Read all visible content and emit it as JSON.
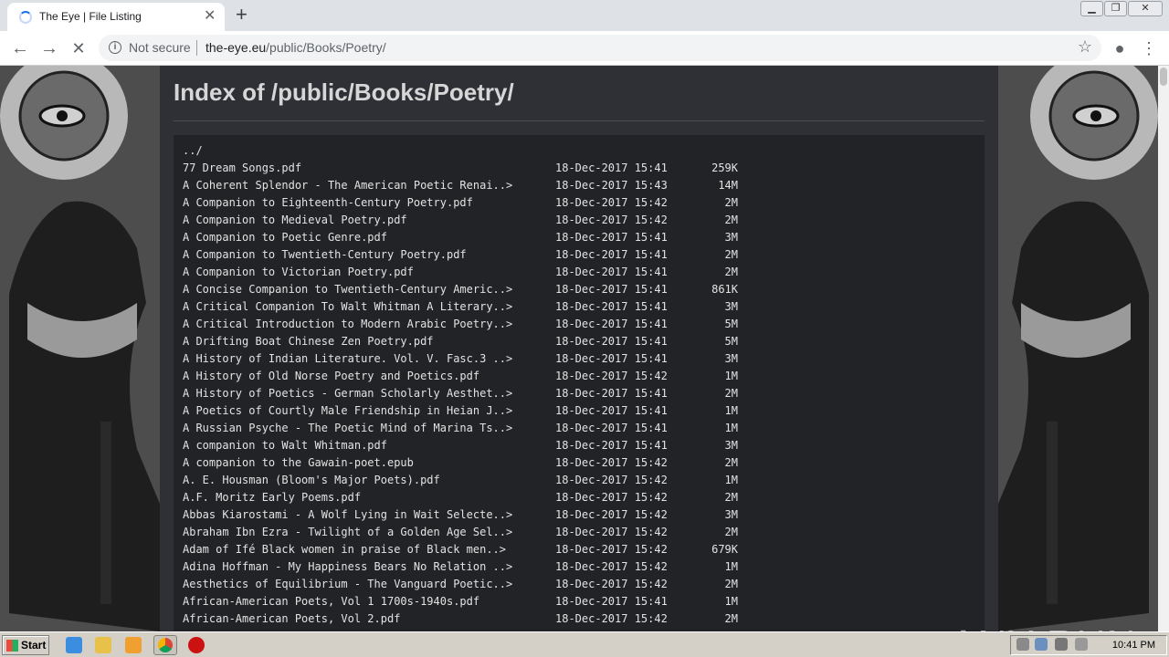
{
  "browser": {
    "tab_title": "The Eye | File Listing",
    "tab_close": "✕",
    "new_tab": "+",
    "not_secure": "Not secure",
    "url_host": "the-eye.eu",
    "url_path": "/public/Books/Poetry/"
  },
  "page": {
    "heading": "Index of /public/Books/Poetry/",
    "parent_link": "../",
    "files": [
      {
        "name": "77 Dream Songs.pdf",
        "date": "18-Dec-2017 15:41",
        "size": "259K"
      },
      {
        "name": "A Coherent Splendor - The American Poetic Renai..>",
        "date": "18-Dec-2017 15:43",
        "size": "14M"
      },
      {
        "name": "A Companion to Eighteenth-Century Poetry.pdf",
        "date": "18-Dec-2017 15:42",
        "size": "2M"
      },
      {
        "name": "A Companion to Medieval Poetry.pdf",
        "date": "18-Dec-2017 15:42",
        "size": "2M"
      },
      {
        "name": "A Companion to Poetic Genre.pdf",
        "date": "18-Dec-2017 15:41",
        "size": "3M"
      },
      {
        "name": "A Companion to Twentieth-Century Poetry.pdf",
        "date": "18-Dec-2017 15:41",
        "size": "2M"
      },
      {
        "name": "A Companion to Victorian Poetry.pdf",
        "date": "18-Dec-2017 15:41",
        "size": "2M"
      },
      {
        "name": "A Concise Companion to Twentieth-Century Americ..>",
        "date": "18-Dec-2017 15:41",
        "size": "861K"
      },
      {
        "name": "A Critical Companion To Walt Whitman A Literary..>",
        "date": "18-Dec-2017 15:41",
        "size": "3M"
      },
      {
        "name": "A Critical Introduction to Modern Arabic Poetry..>",
        "date": "18-Dec-2017 15:41",
        "size": "5M"
      },
      {
        "name": "A Drifting Boat Chinese Zen Poetry.pdf",
        "date": "18-Dec-2017 15:41",
        "size": "5M"
      },
      {
        "name": "A History of Indian Literature. Vol. V. Fasc.3 ..>",
        "date": "18-Dec-2017 15:41",
        "size": "3M"
      },
      {
        "name": "A History of Old Norse Poetry and Poetics.pdf",
        "date": "18-Dec-2017 15:42",
        "size": "1M"
      },
      {
        "name": "A History of Poetics - German Scholarly Aesthet..>",
        "date": "18-Dec-2017 15:41",
        "size": "2M"
      },
      {
        "name": "A Poetics of Courtly Male Friendship in Heian J..>",
        "date": "18-Dec-2017 15:41",
        "size": "1M"
      },
      {
        "name": "A Russian Psyche - The Poetic Mind of Marina Ts..>",
        "date": "18-Dec-2017 15:41",
        "size": "1M"
      },
      {
        "name": "A companion to Walt Whitman.pdf",
        "date": "18-Dec-2017 15:41",
        "size": "3M"
      },
      {
        "name": "A companion to the Gawain-poet.epub",
        "date": "18-Dec-2017 15:42",
        "size": "2M"
      },
      {
        "name": "A. E. Housman (Bloom's Major Poets).pdf",
        "date": "18-Dec-2017 15:42",
        "size": "1M"
      },
      {
        "name": "A.F. Moritz Early Poems.pdf",
        "date": "18-Dec-2017 15:42",
        "size": "2M"
      },
      {
        "name": "Abbas Kiarostami - A Wolf Lying in Wait Selecte..>",
        "date": "18-Dec-2017 15:42",
        "size": "3M"
      },
      {
        "name": "Abraham Ibn Ezra - Twilight of a Golden Age Sel..>",
        "date": "18-Dec-2017 15:42",
        "size": "2M"
      },
      {
        "name": "Adam of Ifé Black women in praise of Black men..>",
        "date": "18-Dec-2017 15:42",
        "size": "679K"
      },
      {
        "name": "Adina Hoffman - My Happiness Bears No Relation ..>",
        "date": "18-Dec-2017 15:42",
        "size": "1M"
      },
      {
        "name": "Aesthetics of Equilibrium - The Vanguard Poetic..>",
        "date": "18-Dec-2017 15:42",
        "size": "2M"
      },
      {
        "name": "African-American Poets, Vol 1 1700s-1940s.pdf",
        "date": "18-Dec-2017 15:41",
        "size": "1M"
      },
      {
        "name": "African-American Poets, Vol 2.pdf",
        "date": "18-Dec-2017 15:42",
        "size": "2M"
      }
    ]
  },
  "watermark": "ANY RUN",
  "taskbar": {
    "start_label": "Start",
    "clock": "10:41 PM"
  },
  "colors": {
    "page_bg": "#2e3035",
    "listing_bg": "#222327",
    "text": "#e3e3e3"
  }
}
